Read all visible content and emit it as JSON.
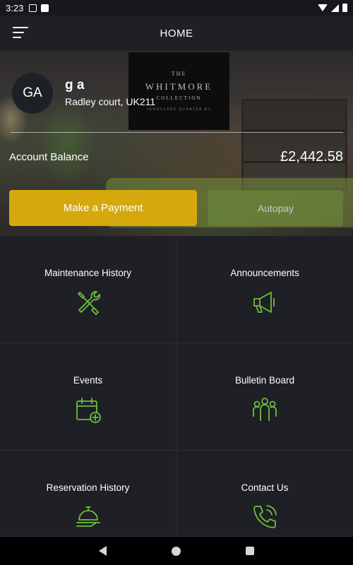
{
  "status_bar": {
    "time": "3:23"
  },
  "app_bar": {
    "title": "HOME",
    "menu_icon": "hamburger-menu-icon"
  },
  "property": {
    "logo": {
      "the": "THE",
      "name": "WHITMORE",
      "collection": "COLLECTION",
      "sub": "JEWELLERY QUARTER B3"
    }
  },
  "user": {
    "initials": "GA",
    "name": "g a",
    "address": "Radley court, UK211"
  },
  "account": {
    "balance_label": "Account Balance",
    "balance_value": "£2,442.58"
  },
  "actions": {
    "pay_label": "Make a Payment",
    "autopay_label": "Autopay"
  },
  "colors": {
    "accent": "#d5a90d",
    "icon_green": "#6bbf3a",
    "background": "#1e2025"
  },
  "tiles": [
    {
      "label": "Maintenance History",
      "icon": "tools-icon"
    },
    {
      "label": "Announcements",
      "icon": "megaphone-icon"
    },
    {
      "label": "Events",
      "icon": "calendar-add-icon"
    },
    {
      "label": "Bulletin Board",
      "icon": "group-icon"
    },
    {
      "label": "Reservation History",
      "icon": "service-bell-icon"
    },
    {
      "label": "Contact Us",
      "icon": "phone-call-icon"
    }
  ]
}
